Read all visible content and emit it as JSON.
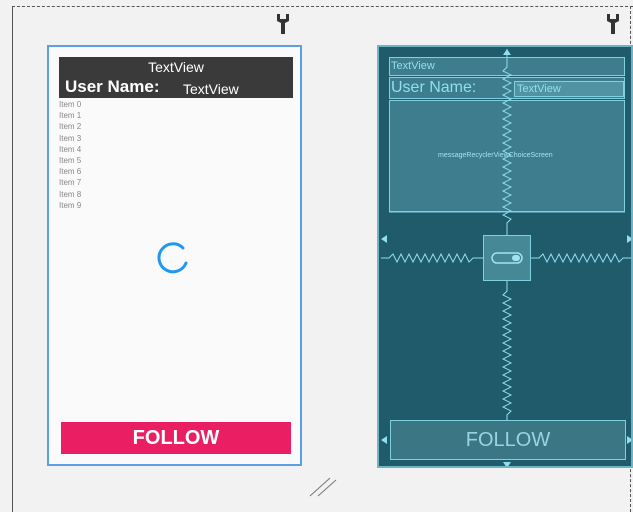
{
  "design": {
    "header_title": "TextView",
    "user_label": "User Name:",
    "user_value": "TextView",
    "list_items": [
      "Item 0",
      "Item 1",
      "Item 2",
      "Item 3",
      "Item 4",
      "Item 5",
      "Item 6",
      "Item 7",
      "Item 8",
      "Item 9"
    ],
    "follow_label": "FOLLOW",
    "colors": {
      "follow_bg": "#e91e63",
      "header_bg": "#3a3a3a",
      "spinner": "#2196f3"
    }
  },
  "blueprint": {
    "header_title": "TextView",
    "user_label": "User Name:",
    "user_value": "TextView",
    "recycler_id": "messageRecyclerViewChoiceScreen",
    "follow_label": "FOLLOW",
    "colors": {
      "bg": "#1f5b6b",
      "line": "#7fd0e0"
    }
  },
  "icons": {
    "wrench_left": "wrench-icon",
    "wrench_right": "wrench-icon",
    "resize": "resize-handle-icon"
  }
}
